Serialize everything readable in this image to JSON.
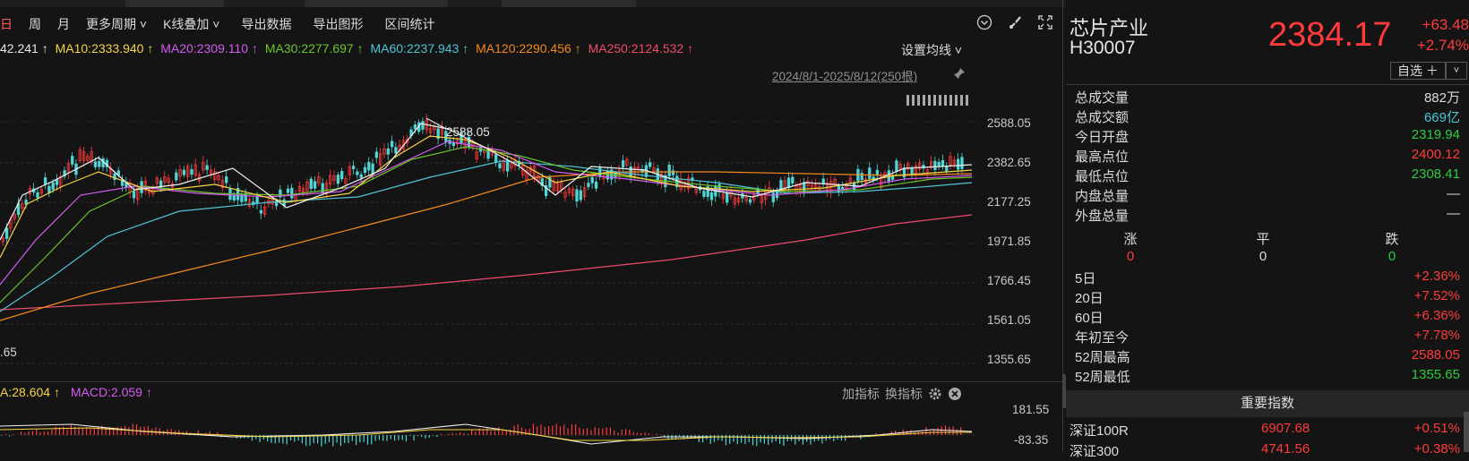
{
  "toolbar": {
    "items": [
      "日",
      "周",
      "月",
      "更多周期 ˅",
      "K线叠加 ˅",
      "导出数据",
      "导出图形",
      "区间统计"
    ]
  },
  "ma": {
    "items": [
      {
        "label": "42.241 ↑",
        "color": "#e8e8e8"
      },
      {
        "label": "MA10:2333.940 ↑",
        "color": "#f5d442"
      },
      {
        "label": "MA20:2309.110 ↑",
        "color": "#d35cf0"
      },
      {
        "label": "MA30:2277.697 ↑",
        "color": "#6bc52b"
      },
      {
        "label": "MA60:2237.943 ↑",
        "color": "#4fc3d6"
      },
      {
        "label": "MA120:2290.456 ↑",
        "color": "#f28a1e"
      },
      {
        "label": "MA250:2124.532 ↑",
        "color": "#f04a6e"
      }
    ],
    "settings_label": "设置均线 ˅"
  },
  "range_label": "2024/8/1-2025/8/12(250根)",
  "price_axis": [
    "2588.05",
    "2382.65",
    "2177.25",
    "1971.85",
    "1766.45",
    "1561.05",
    "1355.65"
  ],
  "high_marker": "2588.05",
  "low_marker": ".65",
  "macd": {
    "items": [
      {
        "label": "A:28.604 ↑",
        "color": "#f5d442"
      },
      {
        "label": "MACD:2.059 ↑",
        "color": "#d35cf0"
      }
    ],
    "add_label": "加指标",
    "switch_label": "换指标",
    "axis": [
      "181.55",
      "-83.35"
    ]
  },
  "quote": {
    "name": "芯片产业",
    "code": "H30007",
    "price": "2384.17",
    "change": "+63.48",
    "change_pct": "+2.74%",
    "watch_label": "自选 ＋",
    "dropdown": "˅"
  },
  "stats": [
    {
      "k": "总成交量",
      "v": "882万",
      "color": "#dcdcdc"
    },
    {
      "k": "总成交额",
      "v": "669亿",
      "color": "#4fc3d6"
    },
    {
      "k": "今日开盘",
      "v": "2319.94",
      "color": "#2ecc40"
    },
    {
      "k": "最高点位",
      "v": "2400.12",
      "color": "#ff3b3b"
    },
    {
      "k": "最低点位",
      "v": "2308.41",
      "color": "#2ecc40"
    },
    {
      "k": "内盘总量",
      "v": "—",
      "color": "#dcdcdc"
    },
    {
      "k": "外盘总量",
      "v": "—",
      "color": "#dcdcdc"
    }
  ],
  "updown": {
    "labels": [
      "涨",
      "平",
      "跌"
    ],
    "values": [
      "0",
      "0",
      "0"
    ]
  },
  "perf": [
    {
      "k": "5日",
      "v": "+2.36%",
      "color": "#ff3b3b"
    },
    {
      "k": "20日",
      "v": "+7.52%",
      "color": "#ff3b3b"
    },
    {
      "k": "60日",
      "v": "+6.36%",
      "color": "#ff3b3b"
    },
    {
      "k": "年初至今",
      "v": "+7.78%",
      "color": "#ff3b3b"
    },
    {
      "k": "52周最高",
      "v": "2588.05",
      "color": "#ff3b3b"
    },
    {
      "k": "52周最低",
      "v": "1355.65",
      "color": "#2ecc40"
    }
  ],
  "important": {
    "title": "重要指数",
    "rows": [
      {
        "n": "深证100R",
        "p": "6907.68",
        "c": "+0.51%"
      },
      {
        "n": "深证300",
        "p": "4741.56",
        "c": "+0.38%"
      }
    ]
  },
  "colors": {
    "up": "#ff3b3b",
    "down": "#2ecc40",
    "bg": "#141414"
  }
}
